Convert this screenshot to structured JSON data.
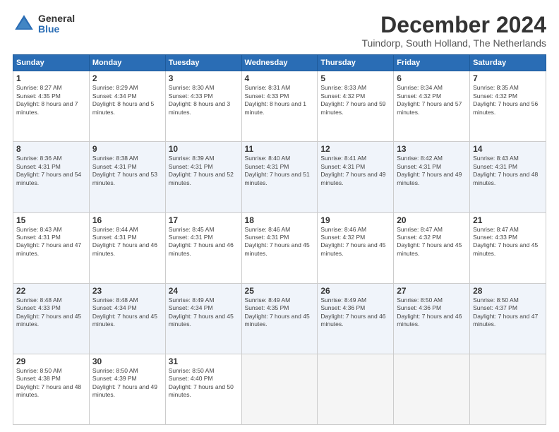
{
  "logo": {
    "general": "General",
    "blue": "Blue"
  },
  "title": "December 2024",
  "subtitle": "Tuindorp, South Holland, The Netherlands",
  "headers": [
    "Sunday",
    "Monday",
    "Tuesday",
    "Wednesday",
    "Thursday",
    "Friday",
    "Saturday"
  ],
  "weeks": [
    [
      {
        "day": "1",
        "sunrise": "Sunrise: 8:27 AM",
        "sunset": "Sunset: 4:35 PM",
        "daylight": "Daylight: 8 hours and 7 minutes."
      },
      {
        "day": "2",
        "sunrise": "Sunrise: 8:29 AM",
        "sunset": "Sunset: 4:34 PM",
        "daylight": "Daylight: 8 hours and 5 minutes."
      },
      {
        "day": "3",
        "sunrise": "Sunrise: 8:30 AM",
        "sunset": "Sunset: 4:33 PM",
        "daylight": "Daylight: 8 hours and 3 minutes."
      },
      {
        "day": "4",
        "sunrise": "Sunrise: 8:31 AM",
        "sunset": "Sunset: 4:33 PM",
        "daylight": "Daylight: 8 hours and 1 minute."
      },
      {
        "day": "5",
        "sunrise": "Sunrise: 8:33 AM",
        "sunset": "Sunset: 4:32 PM",
        "daylight": "Daylight: 7 hours and 59 minutes."
      },
      {
        "day": "6",
        "sunrise": "Sunrise: 8:34 AM",
        "sunset": "Sunset: 4:32 PM",
        "daylight": "Daylight: 7 hours and 57 minutes."
      },
      {
        "day": "7",
        "sunrise": "Sunrise: 8:35 AM",
        "sunset": "Sunset: 4:32 PM",
        "daylight": "Daylight: 7 hours and 56 minutes."
      }
    ],
    [
      {
        "day": "8",
        "sunrise": "Sunrise: 8:36 AM",
        "sunset": "Sunset: 4:31 PM",
        "daylight": "Daylight: 7 hours and 54 minutes."
      },
      {
        "day": "9",
        "sunrise": "Sunrise: 8:38 AM",
        "sunset": "Sunset: 4:31 PM",
        "daylight": "Daylight: 7 hours and 53 minutes."
      },
      {
        "day": "10",
        "sunrise": "Sunrise: 8:39 AM",
        "sunset": "Sunset: 4:31 PM",
        "daylight": "Daylight: 7 hours and 52 minutes."
      },
      {
        "day": "11",
        "sunrise": "Sunrise: 8:40 AM",
        "sunset": "Sunset: 4:31 PM",
        "daylight": "Daylight: 7 hours and 51 minutes."
      },
      {
        "day": "12",
        "sunrise": "Sunrise: 8:41 AM",
        "sunset": "Sunset: 4:31 PM",
        "daylight": "Daylight: 7 hours and 49 minutes."
      },
      {
        "day": "13",
        "sunrise": "Sunrise: 8:42 AM",
        "sunset": "Sunset: 4:31 PM",
        "daylight": "Daylight: 7 hours and 49 minutes."
      },
      {
        "day": "14",
        "sunrise": "Sunrise: 8:43 AM",
        "sunset": "Sunset: 4:31 PM",
        "daylight": "Daylight: 7 hours and 48 minutes."
      }
    ],
    [
      {
        "day": "15",
        "sunrise": "Sunrise: 8:43 AM",
        "sunset": "Sunset: 4:31 PM",
        "daylight": "Daylight: 7 hours and 47 minutes."
      },
      {
        "day": "16",
        "sunrise": "Sunrise: 8:44 AM",
        "sunset": "Sunset: 4:31 PM",
        "daylight": "Daylight: 7 hours and 46 minutes."
      },
      {
        "day": "17",
        "sunrise": "Sunrise: 8:45 AM",
        "sunset": "Sunset: 4:31 PM",
        "daylight": "Daylight: 7 hours and 46 minutes."
      },
      {
        "day": "18",
        "sunrise": "Sunrise: 8:46 AM",
        "sunset": "Sunset: 4:31 PM",
        "daylight": "Daylight: 7 hours and 45 minutes."
      },
      {
        "day": "19",
        "sunrise": "Sunrise: 8:46 AM",
        "sunset": "Sunset: 4:32 PM",
        "daylight": "Daylight: 7 hours and 45 minutes."
      },
      {
        "day": "20",
        "sunrise": "Sunrise: 8:47 AM",
        "sunset": "Sunset: 4:32 PM",
        "daylight": "Daylight: 7 hours and 45 minutes."
      },
      {
        "day": "21",
        "sunrise": "Sunrise: 8:47 AM",
        "sunset": "Sunset: 4:33 PM",
        "daylight": "Daylight: 7 hours and 45 minutes."
      }
    ],
    [
      {
        "day": "22",
        "sunrise": "Sunrise: 8:48 AM",
        "sunset": "Sunset: 4:33 PM",
        "daylight": "Daylight: 7 hours and 45 minutes."
      },
      {
        "day": "23",
        "sunrise": "Sunrise: 8:48 AM",
        "sunset": "Sunset: 4:34 PM",
        "daylight": "Daylight: 7 hours and 45 minutes."
      },
      {
        "day": "24",
        "sunrise": "Sunrise: 8:49 AM",
        "sunset": "Sunset: 4:34 PM",
        "daylight": "Daylight: 7 hours and 45 minutes."
      },
      {
        "day": "25",
        "sunrise": "Sunrise: 8:49 AM",
        "sunset": "Sunset: 4:35 PM",
        "daylight": "Daylight: 7 hours and 45 minutes."
      },
      {
        "day": "26",
        "sunrise": "Sunrise: 8:49 AM",
        "sunset": "Sunset: 4:36 PM",
        "daylight": "Daylight: 7 hours and 46 minutes."
      },
      {
        "day": "27",
        "sunrise": "Sunrise: 8:50 AM",
        "sunset": "Sunset: 4:36 PM",
        "daylight": "Daylight: 7 hours and 46 minutes."
      },
      {
        "day": "28",
        "sunrise": "Sunrise: 8:50 AM",
        "sunset": "Sunset: 4:37 PM",
        "daylight": "Daylight: 7 hours and 47 minutes."
      }
    ],
    [
      {
        "day": "29",
        "sunrise": "Sunrise: 8:50 AM",
        "sunset": "Sunset: 4:38 PM",
        "daylight": "Daylight: 7 hours and 48 minutes."
      },
      {
        "day": "30",
        "sunrise": "Sunrise: 8:50 AM",
        "sunset": "Sunset: 4:39 PM",
        "daylight": "Daylight: 7 hours and 49 minutes."
      },
      {
        "day": "31",
        "sunrise": "Sunrise: 8:50 AM",
        "sunset": "Sunset: 4:40 PM",
        "daylight": "Daylight: 7 hours and 50 minutes."
      },
      null,
      null,
      null,
      null
    ]
  ]
}
